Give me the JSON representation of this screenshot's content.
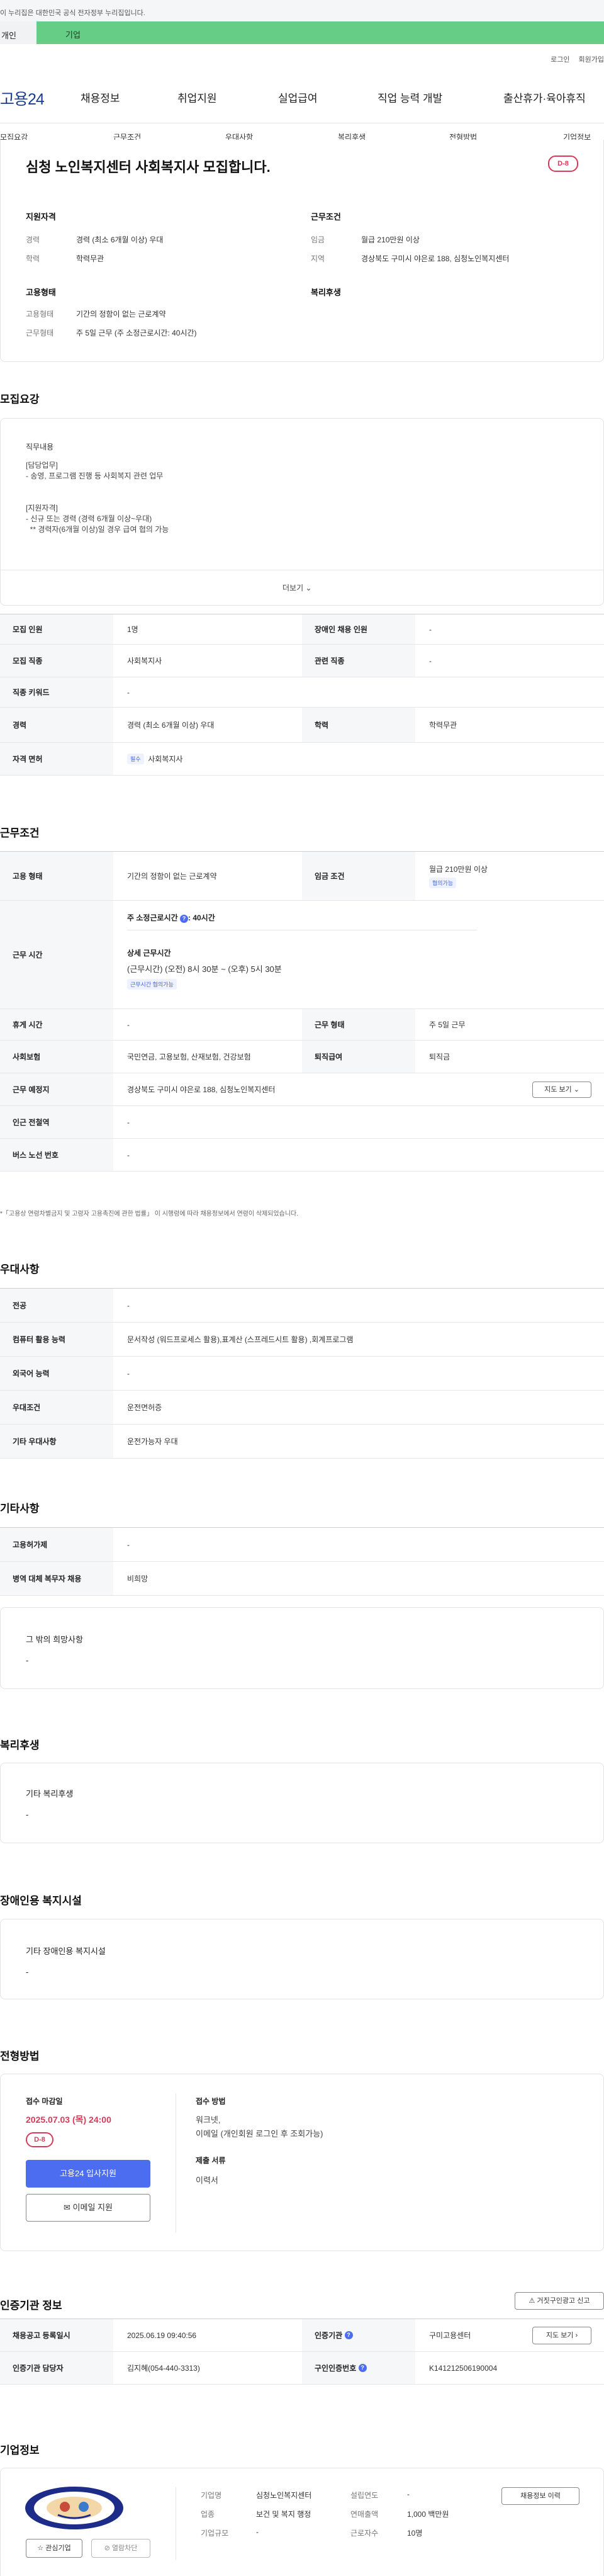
{
  "gov_banner": "이 누리집은 대한민국 공식 전자정부 누리집입니다.",
  "service_tabs": {
    "a": "개인",
    "b": "기업"
  },
  "util": {
    "login": "로그인",
    "signup": "회원가입"
  },
  "logo": "고용24",
  "gnb": [
    "채용정보",
    "취업지원",
    "실업급여",
    "직업 능력 개발",
    "출산휴가·육아휴직"
  ],
  "subnav": [
    "모집요강",
    "근무조건",
    "우대사항",
    "복리후생",
    "전형방법",
    "기업정보"
  ],
  "summary": {
    "title": "심청 노인복지센터 사회복지사 모집합니다.",
    "dday": "D-8",
    "qual_head": "지원자격",
    "career_label": "경력",
    "career_value": "경력 (최소 6개월 이상) 우대",
    "edu_label": "학력",
    "edu_value": "학력무관",
    "cond_head": "근무조건",
    "wage_label": "임금",
    "wage_value": "월급 210만원 이상",
    "area_label": "지역",
    "area_value": "경상북도 구미시 야은로 188, 심청노인복지센터",
    "emp_head": "고용형태",
    "emp_label": "고용형태",
    "emp_value": "기간의 정함이 없는 근로계약",
    "worktype_label": "근무형태",
    "worktype_value": "주 5일 근무 (주 소정근로시간: 40시간)",
    "welfare_head": "복리후생"
  },
  "recruit": {
    "title": "모집요강",
    "job_head": "직무내용",
    "job_lines": [
      "[담당업무]",
      "- 송영, 프로그램 진행 등 사회복지 관련 업무",
      "",
      "",
      "[지원자격]",
      "- 신규 또는 경력 (경력 6개월 이상~우대)",
      "  ** 경력자(6개월 이상)일 경우 급여 협의 가능"
    ],
    "more": "더보기",
    "rows": [
      {
        "l1": "모집 인원",
        "v1": "1명",
        "l2": "장애인 채용 인원",
        "v2": "-"
      },
      {
        "l1": "모집 직종",
        "v1": "사회복지사",
        "l2": "관련 직종",
        "v2": "-"
      },
      {
        "l1": "직종 키워드",
        "v1": "-"
      },
      {
        "l1": "경력",
        "v1": "경력 (최소 6개월 이상) 우대",
        "l2": "학력",
        "v2": "학력무관"
      },
      {
        "l1": "자격 면허",
        "tag": "필수",
        "v1": "사회복지사"
      }
    ]
  },
  "conditions": {
    "title": "근무조건",
    "emp_label": "고용 형태",
    "emp_value": "기간의 정함이 없는 근로계약",
    "wage_label": "임금 조건",
    "wage_value": "월급 210만원 이상",
    "wage_tag": "협의가능",
    "hours_label": "근무 시간",
    "hours_main": "주 소정근로시간",
    "hours_value": "40시간",
    "hours_detail_head": "상세 근무시간",
    "hours_detail": "(근무시간) (오전) 8시 30분 ~ (오후) 5시 30분",
    "hours_tag": "근무시간 협의가능",
    "break_label": "휴게 시간",
    "break_value": "-",
    "worktype_label": "근무 형태",
    "worktype_value": "주 5일 근무",
    "ins_label": "사회보험",
    "ins_value": "국민연금, 고용보험, 산재보험, 건강보험",
    "retire_label": "퇴직급여",
    "retire_value": "퇴직금",
    "place_label": "근무 예정지",
    "place_value": "경상북도 구미시 야은로 188, 심청노인복지센터",
    "map_btn": "지도 보기",
    "subway_label": "인근 전철역",
    "subway_value": "-",
    "bus_label": "버스 노선 번호",
    "bus_value": "-",
    "note": "*「고용상 연령차별금지 및 고령자 고용촉진에 관한 법률」 이 시행령에 따라 채용정보에서 연령이 삭제되었습니다."
  },
  "preference": {
    "title": "우대사항",
    "rows": [
      {
        "l": "전공",
        "v": "-"
      },
      {
        "l": "컴퓨터 활용 능력",
        "v": "문서작성 (워드프로세스 활용),표계산 (스프레드시트 활용) ,회계프로그램"
      },
      {
        "l": "외국어 능력",
        "v": "-"
      },
      {
        "l": "우대조건",
        "v": "운전면허증"
      },
      {
        "l": "기타 우대사항",
        "v": "운전가능자 우대"
      }
    ]
  },
  "etc": {
    "title": "기타사항",
    "rows": [
      {
        "l": "고용허가제",
        "v": "-"
      },
      {
        "l": "병역 대체 복무자 채용",
        "v": "비희망"
      }
    ],
    "box_head": "그 밖의 희망사항",
    "box_value": "-"
  },
  "welfare": {
    "title": "복리후생",
    "box_head": "기타 복리후생",
    "box_value": "-"
  },
  "disability": {
    "title": "장애인용 복지시설",
    "box_head": "기타 장애인용 복지시설",
    "box_value": "-"
  },
  "process": {
    "title": "전형방법",
    "deadline_head": "접수 마감일",
    "deadline": "2025.07.03 (목) 24:00",
    "dday": "D-8",
    "apply_btn": "고용24 입사지원",
    "email_btn": "이메일 지원",
    "method_head": "접수 방법",
    "method_lines": [
      "워크넷,",
      "이메일 (개인회원 로그인 후 조회가능)"
    ],
    "docs_head": "제출 서류",
    "docs_value": "이력서"
  },
  "agency": {
    "title": "인증기관 정보",
    "report_btn": "거짓구인광고 신고",
    "r1_l1": "채용공고 등록일시",
    "r1_v1": "2025.06.19 09:40:56",
    "r1_l2": "인증기관",
    "r1_v2": "구미고용센터",
    "r1_btn": "지도 보기",
    "r2_l1": "인증기관 담당자",
    "r2_v1": "김지혜(054-440-3313)",
    "r2_l2": "구인인증번호",
    "r2_v2": "K141212506190004"
  },
  "company": {
    "title": "기업정보",
    "name_label": "기업명",
    "name_value": "심청노인복지센터",
    "year_label": "설립연도",
    "year_value": "-",
    "industry_label": "업종",
    "industry_value": "보건 및 복지 행정",
    "sales_label": "연매출액",
    "sales_value": "1,000 백만원",
    "size_label": "기업규모",
    "size_value": "-",
    "staff_label": "근로자수",
    "staff_value": "10명",
    "jobs_btn": "채용정보 이력",
    "fav_btn": "관심기업",
    "block_btn": "열람차단"
  }
}
